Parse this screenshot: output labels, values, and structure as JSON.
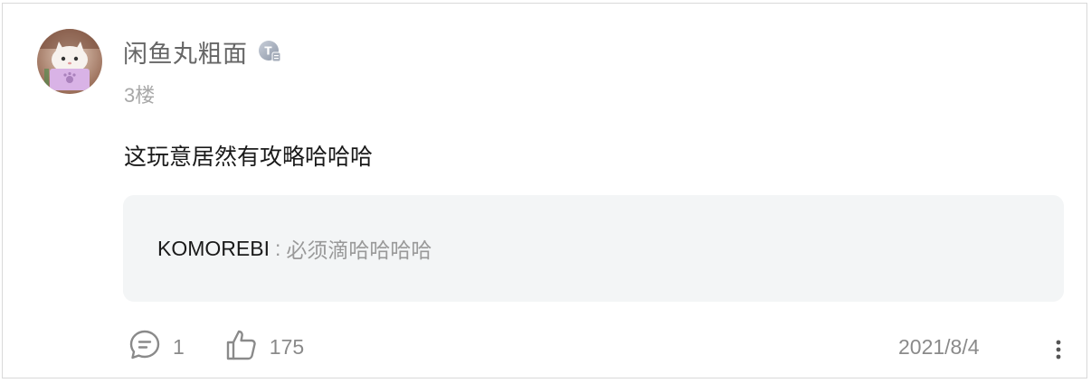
{
  "post": {
    "author": "闲鱼丸粗面",
    "floor": "3楼",
    "content": "这玩意居然有攻略哈哈哈"
  },
  "reply": {
    "author": "KOMOREBI",
    "separator": ":",
    "text": "必须滴哈哈哈哈"
  },
  "actions": {
    "comment_count": "1",
    "like_count": "175"
  },
  "date": "2021/8/4",
  "icons": {
    "level_badge": "level-badge-icon",
    "comment": "comment-icon",
    "like": "thumbs-up-icon",
    "more": "more-vertical-icon"
  }
}
